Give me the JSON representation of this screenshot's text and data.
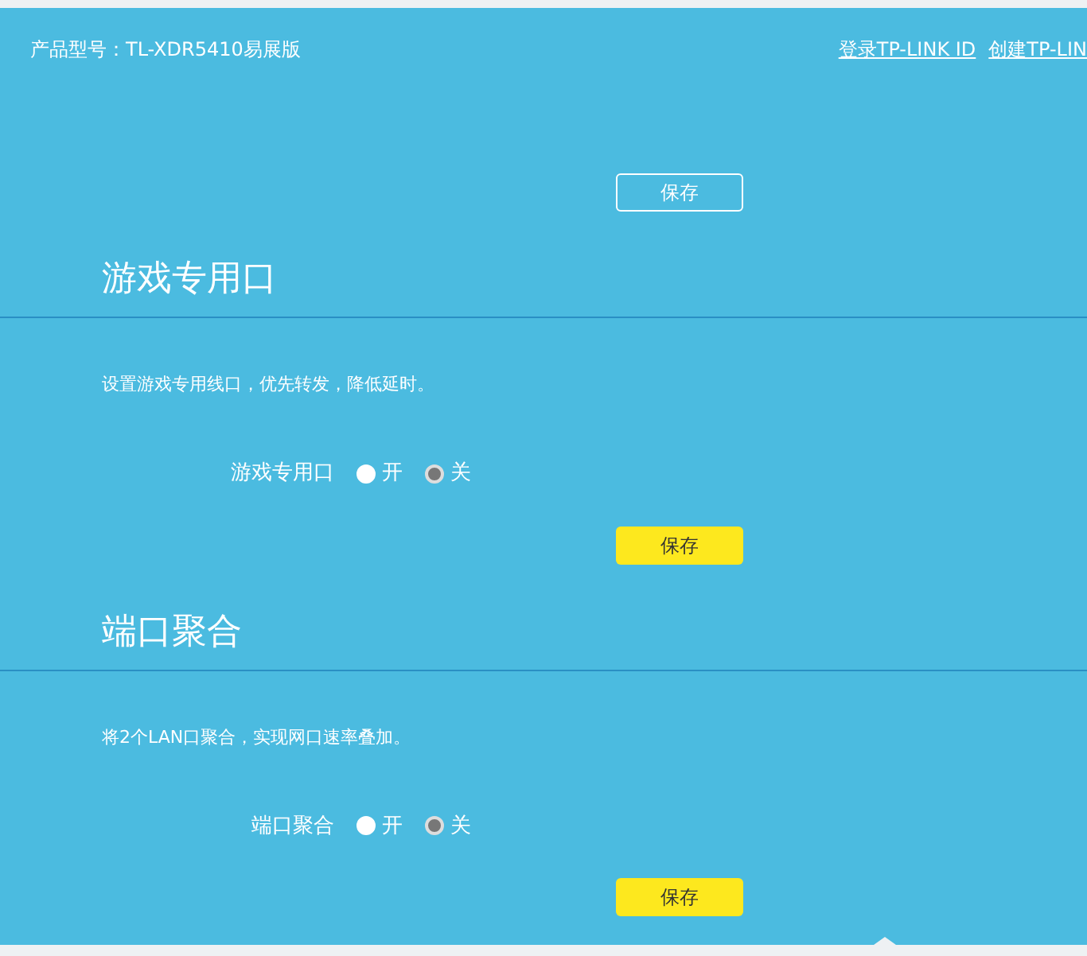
{
  "header": {
    "model": "产品型号：TL-XDR5410易展版",
    "links": [
      "登录TP-LINK ID",
      "创建TP-LIN"
    ]
  },
  "top_save": {
    "label": "保存"
  },
  "sections": [
    {
      "title": "游戏专用口",
      "description": "设置游戏专用线口，优先转发，降低延时。",
      "field_label": "游戏专用口",
      "options": [
        {
          "label": "开",
          "selected": false
        },
        {
          "label": "关",
          "selected": true
        }
      ],
      "save": "保存"
    },
    {
      "title": "端口聚合",
      "description": "将2个LAN口聚合，实现网口速率叠加。",
      "field_label": "端口聚合",
      "options": [
        {
          "label": "开",
          "selected": false
        },
        {
          "label": "关",
          "selected": true
        }
      ],
      "save": "保存"
    }
  ]
}
